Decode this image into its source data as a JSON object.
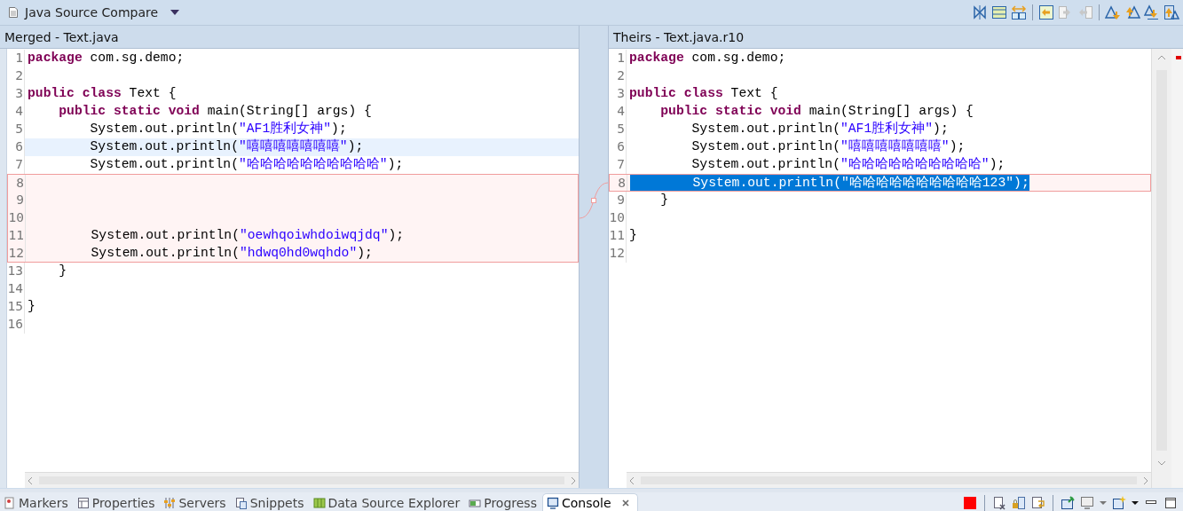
{
  "editor_tab": {
    "title": "Java Source Compare"
  },
  "toolbar": [
    {
      "kind": "ignore-whitespace",
      "disabled": false
    },
    {
      "kind": "structure-pane",
      "disabled": false
    },
    {
      "kind": "swap-sides",
      "disabled": false
    },
    {
      "kind": "sep"
    },
    {
      "kind": "copy-all-left",
      "disabled": false
    },
    {
      "kind": "copy-all-right",
      "disabled": true
    },
    {
      "kind": "copy-current-left",
      "disabled": true
    },
    {
      "kind": "sep"
    },
    {
      "kind": "next-diff",
      "disabled": false
    },
    {
      "kind": "prev-diff",
      "disabled": false
    },
    {
      "kind": "next-change",
      "disabled": false
    },
    {
      "kind": "prev-change",
      "disabled": false
    }
  ],
  "panes": [
    {
      "title": "Merged - Text.java",
      "lines": [
        {
          "number": "1",
          "tokens": [
            {
              "kind": "kw",
              "text": "package"
            },
            {
              "kind": "plain",
              "text": " com.sg.demo;"
            }
          ],
          "in_change": false
        },
        {
          "number": "2",
          "in_change": false
        },
        {
          "number": "3",
          "tokens": [
            {
              "kind": "kw",
              "text": "public class"
            },
            {
              "kind": "plain",
              "text": " Text {"
            }
          ],
          "in_change": false
        },
        {
          "number": "4",
          "tokens": [
            {
              "kind": "kw",
              "text": "    public static void"
            },
            {
              "kind": "plain",
              "text": " main(String[] args) {"
            }
          ],
          "in_change": false
        },
        {
          "number": "5",
          "tokens": [
            {
              "kind": "plain",
              "text": "        System.out.println("
            },
            {
              "kind": "str",
              "text": "\"AF1胜利女神\""
            },
            {
              "kind": "plain",
              "text": ");"
            }
          ],
          "in_change": false
        },
        {
          "number": "6",
          "tokens": [
            {
              "kind": "plain",
              "text": "        System.out.println("
            },
            {
              "kind": "str",
              "text": "\"嘻嘻嘻嘻嘻嘻嘻\""
            },
            {
              "kind": "plain",
              "text": ");"
            }
          ],
          "in_change": false,
          "current": true
        },
        {
          "number": "7",
          "tokens": [
            {
              "kind": "plain",
              "text": "        System.out.println("
            },
            {
              "kind": "str",
              "text": "\"哈哈哈哈哈哈哈哈哈哈\""
            },
            {
              "kind": "plain",
              "text": ");"
            }
          ],
          "in_change": false
        },
        {
          "number": "8",
          "in_change": true
        },
        {
          "number": "9",
          "in_change": true
        },
        {
          "number": "10",
          "in_change": true
        },
        {
          "number": "11",
          "tokens": [
            {
              "kind": "plain",
              "text": "        System.out.println("
            },
            {
              "kind": "str",
              "text": "\"oewhqoiwhdoiwqjdq\""
            },
            {
              "kind": "plain",
              "text": ");"
            }
          ],
          "in_change": true
        },
        {
          "number": "12",
          "tokens": [
            {
              "kind": "plain",
              "text": "        System.out.println("
            },
            {
              "kind": "str",
              "text": "\"hdwq0hd0wqhdo\""
            },
            {
              "kind": "plain",
              "text": ");"
            }
          ],
          "in_change": true
        },
        {
          "number": "13",
          "tokens": [
            {
              "kind": "plain",
              "text": "    }"
            }
          ],
          "in_change": false
        },
        {
          "number": "14",
          "in_change": false
        },
        {
          "number": "15",
          "tokens": [
            {
              "kind": "plain",
              "text": "}"
            }
          ],
          "in_change": false
        },
        {
          "number": "16",
          "in_change": false
        }
      ]
    },
    {
      "title": "Theirs - Text.java.r10",
      "lines": [
        {
          "number": "1",
          "tokens": [
            {
              "kind": "kw",
              "text": "package"
            },
            {
              "kind": "plain",
              "text": " com.sg.demo;"
            }
          ],
          "in_change": false
        },
        {
          "number": "2",
          "in_change": false
        },
        {
          "number": "3",
          "tokens": [
            {
              "kind": "kw",
              "text": "public class"
            },
            {
              "kind": "plain",
              "text": " Text {"
            }
          ],
          "in_change": false
        },
        {
          "number": "4",
          "tokens": [
            {
              "kind": "kw",
              "text": "    public static void"
            },
            {
              "kind": "plain",
              "text": " main(String[] args) {"
            }
          ],
          "in_change": false
        },
        {
          "number": "5",
          "tokens": [
            {
              "kind": "plain",
              "text": "        System.out.println("
            },
            {
              "kind": "str",
              "text": "\"AF1胜利女神\""
            },
            {
              "kind": "plain",
              "text": ");"
            }
          ],
          "in_change": false
        },
        {
          "number": "6",
          "tokens": [
            {
              "kind": "plain",
              "text": "        System.out.println("
            },
            {
              "kind": "str",
              "text": "\"嘻嘻嘻嘻嘻嘻嘻\""
            },
            {
              "kind": "plain",
              "text": ");"
            }
          ],
          "in_change": false
        },
        {
          "number": "7",
          "tokens": [
            {
              "kind": "plain",
              "text": "        System.out.println("
            },
            {
              "kind": "str",
              "text": "\"哈哈哈哈哈哈哈哈哈哈\""
            },
            {
              "kind": "plain",
              "text": ");"
            }
          ],
          "in_change": false
        },
        {
          "number": "8",
          "tokens": [
            {
              "kind": "plain",
              "text": "        System.out.println("
            },
            {
              "kind": "str",
              "text": "\"哈哈哈哈哈哈哈哈哈哈123\""
            },
            {
              "kind": "plain",
              "text": ");"
            }
          ],
          "in_change": true,
          "selected": true
        },
        {
          "number": "9",
          "tokens": [
            {
              "kind": "plain",
              "text": "    }"
            }
          ],
          "in_change": false
        },
        {
          "number": "10",
          "in_change": false
        },
        {
          "number": "11",
          "tokens": [
            {
              "kind": "plain",
              "text": "}"
            }
          ],
          "in_change": false
        },
        {
          "number": "12",
          "in_change": false
        }
      ]
    }
  ],
  "bottom_tabs": [
    {
      "label": "Markers",
      "kind": "markers",
      "selected": false
    },
    {
      "label": "Properties",
      "kind": "properties",
      "selected": false
    },
    {
      "label": "Servers",
      "kind": "servers",
      "selected": false
    },
    {
      "label": "Snippets",
      "kind": "snippets",
      "selected": false
    },
    {
      "label": "Data Source Explorer",
      "kind": "datasource",
      "selected": false
    },
    {
      "label": "Progress",
      "kind": "progress",
      "selected": false
    },
    {
      "label": "Console",
      "kind": "console",
      "selected": true
    }
  ]
}
